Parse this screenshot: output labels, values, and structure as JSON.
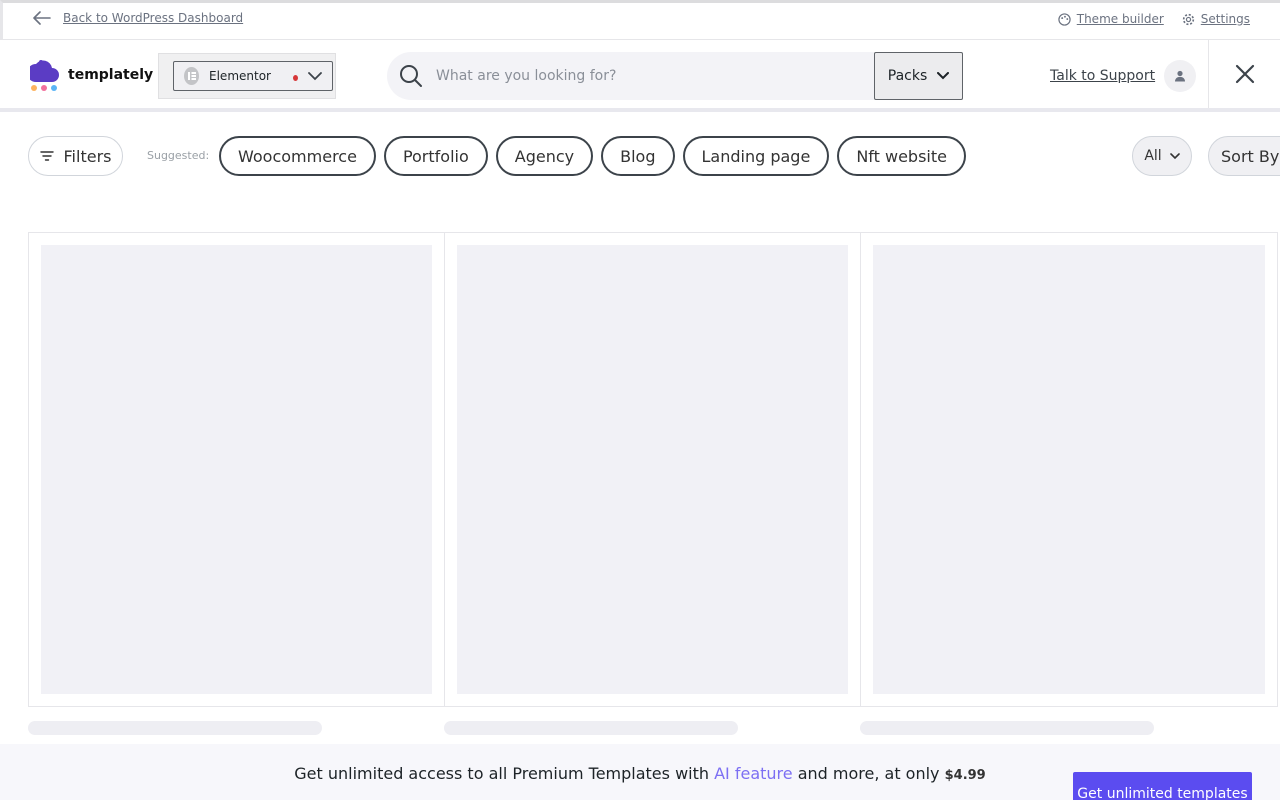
{
  "wp_bar": {
    "back_label": "Back to WordPress Dashboard",
    "theme_builder_label": "Theme builder",
    "settings_label": "Settings"
  },
  "header": {
    "logo_text": "templately",
    "builder": {
      "selected": "Elementor",
      "status_color": "#d63638"
    },
    "search": {
      "placeholder": "What are you looking for?",
      "value": ""
    },
    "type_select": "Packs",
    "support_label": "Talk to Support"
  },
  "filters": {
    "filters_label": "Filters",
    "suggested_label": "Suggested:",
    "chips": [
      "Woocommerce",
      "Portfolio",
      "Agency",
      "Blog",
      "Landing page",
      "Nft website"
    ],
    "plan_select": "All",
    "sort_label": "Sort By"
  },
  "promo": {
    "text_before": "Get unlimited access to all Premium Templates with ",
    "ai_link": "AI feature",
    "text_after": " and more, at only ",
    "price": "$4.99",
    "cta_label": "Get unlimited templates"
  },
  "colors": {
    "accent": "#5b4cf0",
    "ai_link": "#7c6ff3",
    "skeleton": "#f1f1f6"
  }
}
